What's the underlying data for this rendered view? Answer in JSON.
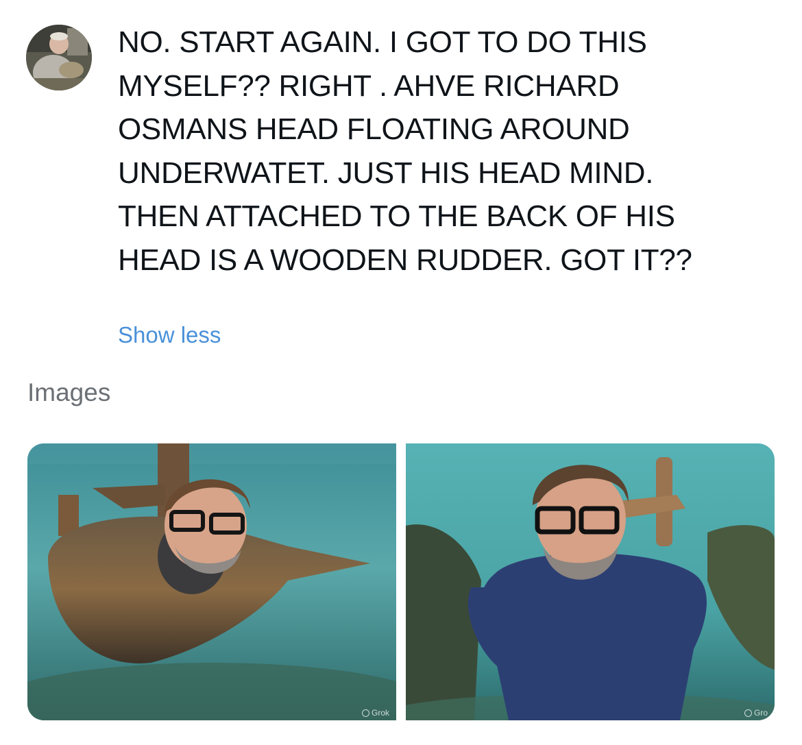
{
  "post": {
    "text_lines": [
      "NO. START AGAIN. I GOT TO DO THIS",
      "MYSELF?? RIGHT . AHVE RICHARD",
      "OSMANS HEAD FLOATING AROUND",
      "UNDERWATET. JUST HIS HEAD MIND.",
      "THEN ATTACHED TO THE BACK OF HIS",
      "HEAD IS A WOODEN RUDDER. GOT IT??"
    ],
    "show_less_label": "Show less"
  },
  "images_section": {
    "title": "Images",
    "images": [
      {
        "watermark": "Grok"
      },
      {
        "watermark": "Gro"
      }
    ]
  },
  "colors": {
    "text": "#0f1419",
    "link": "#4a90d9",
    "muted": "#6b7075",
    "water": "#4f9ea3"
  },
  "icons": {
    "avatar": "user-avatar",
    "watermark": "grok-logo-icon"
  }
}
